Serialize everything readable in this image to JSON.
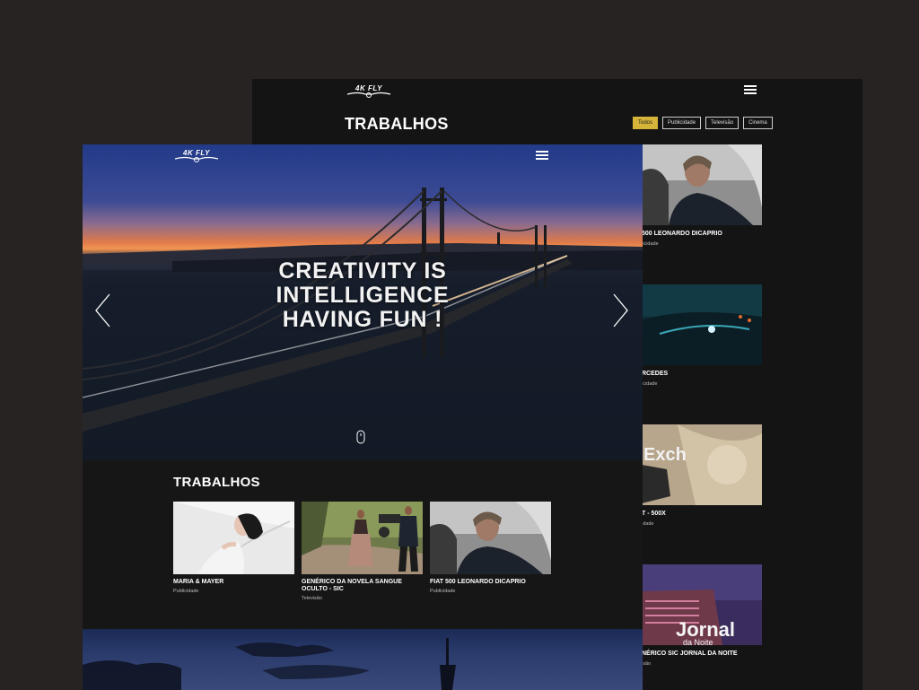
{
  "back_window": {
    "logo_text": "4K FLY",
    "title": "TRABALHOS",
    "filters": [
      {
        "label": "Todos",
        "active": true
      },
      {
        "label": "Publicidade",
        "active": false
      },
      {
        "label": "Televisão",
        "active": false
      },
      {
        "label": "Cinema",
        "active": false
      }
    ],
    "cards": [
      {
        "title": "500 LEONARDO DICAPRIO",
        "category": "licidade"
      },
      {
        "title": "RCEDES",
        "category": "icidade"
      },
      {
        "title": "T - 500X",
        "category": "idade"
      },
      {
        "title": "NÉRICO SIC JORNAL DA NOITE",
        "category": "isão"
      }
    ],
    "thumb_overlay_texts": {
      "exchange": "Exch",
      "jornal": "Jornal",
      "jornal_sub": "da Noite"
    }
  },
  "front_window": {
    "logo_text": "4K FLY",
    "hero": {
      "headline_1": "CREATIVITY IS",
      "headline_2": "INTELLIGENCE",
      "headline_3": "HAVING FUN !"
    },
    "works_title": "TRABALHOS",
    "cards": [
      {
        "title": "MARIA & MAYER",
        "category": "Publicidade"
      },
      {
        "title": "GENÉRICO DA NOVELA SANGUE OCULTO - SIC",
        "category": "Televisão"
      },
      {
        "title": "FIAT 500 LEONARDO DICAPRIO",
        "category": "Publicidade"
      }
    ]
  },
  "colors": {
    "page_bg": "#272323",
    "window_bg": "#141414",
    "accent": "#d6b43a"
  }
}
